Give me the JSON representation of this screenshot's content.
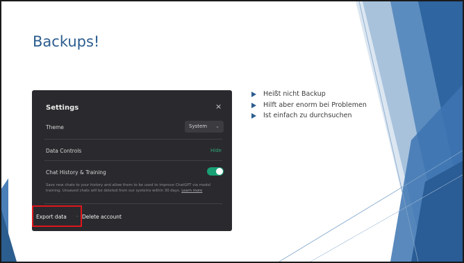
{
  "slide": {
    "title": "Backups!",
    "colors": {
      "title": "#2c5d8f",
      "accent": "#2c5d8f",
      "highlight": "#e0161b"
    }
  },
  "settings_panel": {
    "title": "Settings",
    "close_glyph": "×",
    "theme_label": "Theme",
    "theme_value": "System",
    "theme_chevron": "⌄",
    "data_controls_label": "Data Controls",
    "data_controls_action": "Hide",
    "chat_history_label": "Chat History & Training",
    "chat_history_enabled": true,
    "chat_history_desc": "Save new chats to your history and allow them to be used to improve ChatGPT via model training. Unsaved chats will be deleted from our systems within 30 days.",
    "chat_history_link": "Learn more",
    "export_label": "Export data",
    "separator": "·",
    "delete_label": "Delete account"
  },
  "bullets": [
    "Heißt nicht Backup",
    "Hilft aber enorm bei Problemen",
    "Ist einfach zu durchsuchen"
  ]
}
